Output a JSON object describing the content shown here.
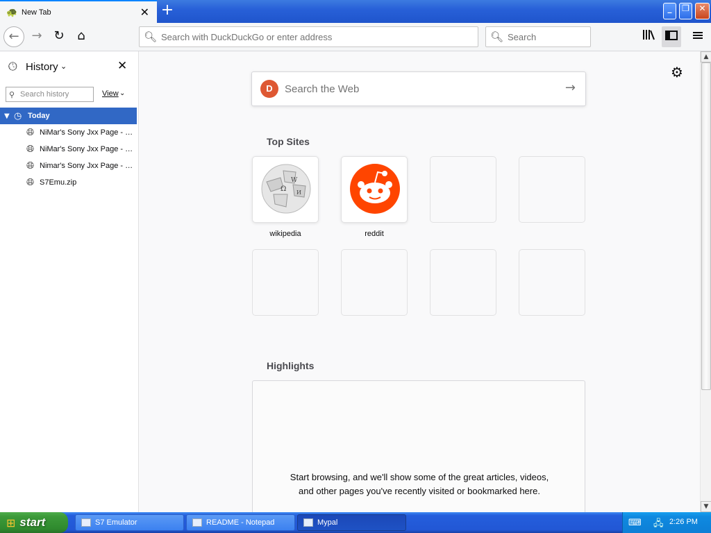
{
  "browser": {
    "tab": {
      "title": "New Tab",
      "close_glyph": "✕"
    },
    "new_tab_glyph": "+",
    "window_buttons": {
      "minimize": "_",
      "maximize": "❐",
      "close": "✕"
    },
    "nav": {
      "back": "←",
      "forward": "→",
      "reload": "↻",
      "home": "⌂"
    },
    "urlbar": {
      "placeholder": "Search with DuckDuckGo or enter address",
      "icon": "search-icon"
    },
    "searchbar": {
      "placeholder": "Search",
      "icon": "search-icon"
    },
    "toolbar_icons": {
      "library": "library-icon",
      "sidebar": "sidebar-icon",
      "menu": "hamburger-menu-icon"
    }
  },
  "sidebar": {
    "title": "History",
    "search_placeholder": "Search history",
    "view_label": "View",
    "group": {
      "label": "Today"
    },
    "items": [
      {
        "label": "NiMar's Sony Jxx Page - M..."
      },
      {
        "label": "NiMar's Sony Jxx Page - M..."
      },
      {
        "label": "Nimar's Sony Jxx Page - S..."
      },
      {
        "label": "S7Emu.zip"
      }
    ]
  },
  "newtab": {
    "search": {
      "placeholder": "Search the Web",
      "engine_icon": "duckduckgo-icon"
    },
    "top_sites_title": "Top Sites",
    "top_sites": [
      {
        "label": "wikipedia",
        "icon": "wikipedia-icon"
      },
      {
        "label": "reddit",
        "icon": "reddit-icon"
      }
    ],
    "highlights_title": "Highlights",
    "highlights_message": "Start browsing, and we'll show some of the great articles, videos, and other pages you've recently visited or bookmarked here."
  },
  "taskbar": {
    "start_label": "start",
    "tasks": [
      {
        "label": "S7 Emulator"
      },
      {
        "label": "README - Notepad"
      },
      {
        "label": "Mypal"
      }
    ],
    "clock": "2:26 PM"
  },
  "colors": {
    "accent": "#0a84ff",
    "sidebar_selection": "#3168c5",
    "reddit": "#ff4500",
    "duckduckgo": "#de5833",
    "xp_start_green": "#3c9a39",
    "xp_taskbar_blue": "#245edc"
  }
}
